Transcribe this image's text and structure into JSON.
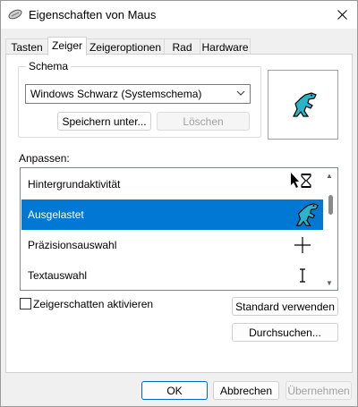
{
  "window": {
    "title": "Eigenschaften von Maus"
  },
  "tabs": [
    {
      "label": "Tasten"
    },
    {
      "label": "Zeiger"
    },
    {
      "label": "Zeigeroptionen"
    },
    {
      "label": "Rad"
    },
    {
      "label": "Hardware"
    }
  ],
  "active_tab": "Zeiger",
  "schema": {
    "legend": "Schema",
    "selected": "Windows Schwarz (Systemschema)",
    "save_label": "Speichern unter...",
    "delete_label": "Löschen"
  },
  "customize": {
    "label": "Anpassen:",
    "items": [
      {
        "label": "Hintergrundaktivität",
        "icon": "arrow-hourglass-cursor-icon"
      },
      {
        "label": "Ausgelastet",
        "icon": "dinosaur-busy-cursor-icon",
        "selected": true
      },
      {
        "label": "Präzisionsauswahl",
        "icon": "crosshair-cursor-icon"
      },
      {
        "label": "Textauswahl",
        "icon": "i-beam-cursor-icon"
      }
    ]
  },
  "shadow_checkbox": {
    "label": "Zeigerschatten aktivieren",
    "checked": false
  },
  "buttons": {
    "default": "Standard verwenden",
    "browse": "Durchsuchen...",
    "ok": "OK",
    "cancel": "Abbrechen",
    "apply": "Übernehmen"
  },
  "colors": {
    "selection": "#0078d4",
    "dino": "#2ab4c6",
    "accent": "#0067c0"
  }
}
